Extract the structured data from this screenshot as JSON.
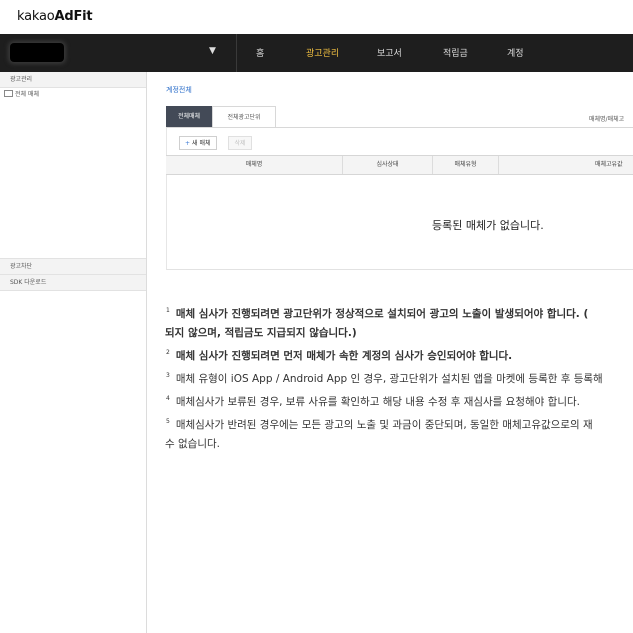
{
  "logo": {
    "prefix": "kakao",
    "suffix": "AdFit"
  },
  "nav": {
    "caret": "▼",
    "items": [
      "홈",
      "광고관리",
      "보고서",
      "적립금",
      "계정"
    ],
    "active_index": 1,
    "active_color": "#f5c242"
  },
  "sidebar": {
    "section_title": "광고관리",
    "tree_item": "전체 매체",
    "section_block": "광고차단",
    "section_sdk": "SDK 다운로드"
  },
  "breadcrumb": "계정전체",
  "tabs": [
    "전체매체",
    "전체광고단위"
  ],
  "right_note": "매체명/매체고",
  "buttons": {
    "new_media": "새 매체",
    "new_media_icon": "plus-icon",
    "delete": "삭제"
  },
  "table": {
    "headers": [
      "매체명",
      "심사상태",
      "매체유형",
      "매체고유값"
    ],
    "empty_message": "등록된 매체가 없습니다."
  },
  "notes": [
    {
      "sup": "1",
      "text": "매체 심사가 진행되려면 광고단위가 정상적으로 설치되어 광고의 노출이 발생되어야 합니다. (",
      "bold": true
    },
    {
      "sup": "",
      "text": "되지 않으며, 적립금도 지급되지 않습니다.)",
      "bold": true
    },
    {
      "sup": "2",
      "text": "매체 심사가 진행되려면 먼저 매체가 속한 계정의 심사가 승인되어야 합니다.",
      "bold": true
    },
    {
      "sup": "3",
      "text": "매체 유형이 iOS App / Android App 인 경우, 광고단위가 설치된 앱을 마켓에 등록한 후 등록해",
      "bold": false
    },
    {
      "sup": "4",
      "text": "매체심사가 보류된 경우, 보류 사유를 확인하고 해당 내용 수정 후 재심사를 요청해야 합니다.",
      "bold": false
    },
    {
      "sup": "5",
      "text": "매체심사가 반려된 경우에는 모든 광고의 노출 및 과금이 중단되며, 동일한 매체고유값으로의 재",
      "bold": false
    },
    {
      "sup": "",
      "text": "수 없습니다.",
      "bold": false
    }
  ]
}
